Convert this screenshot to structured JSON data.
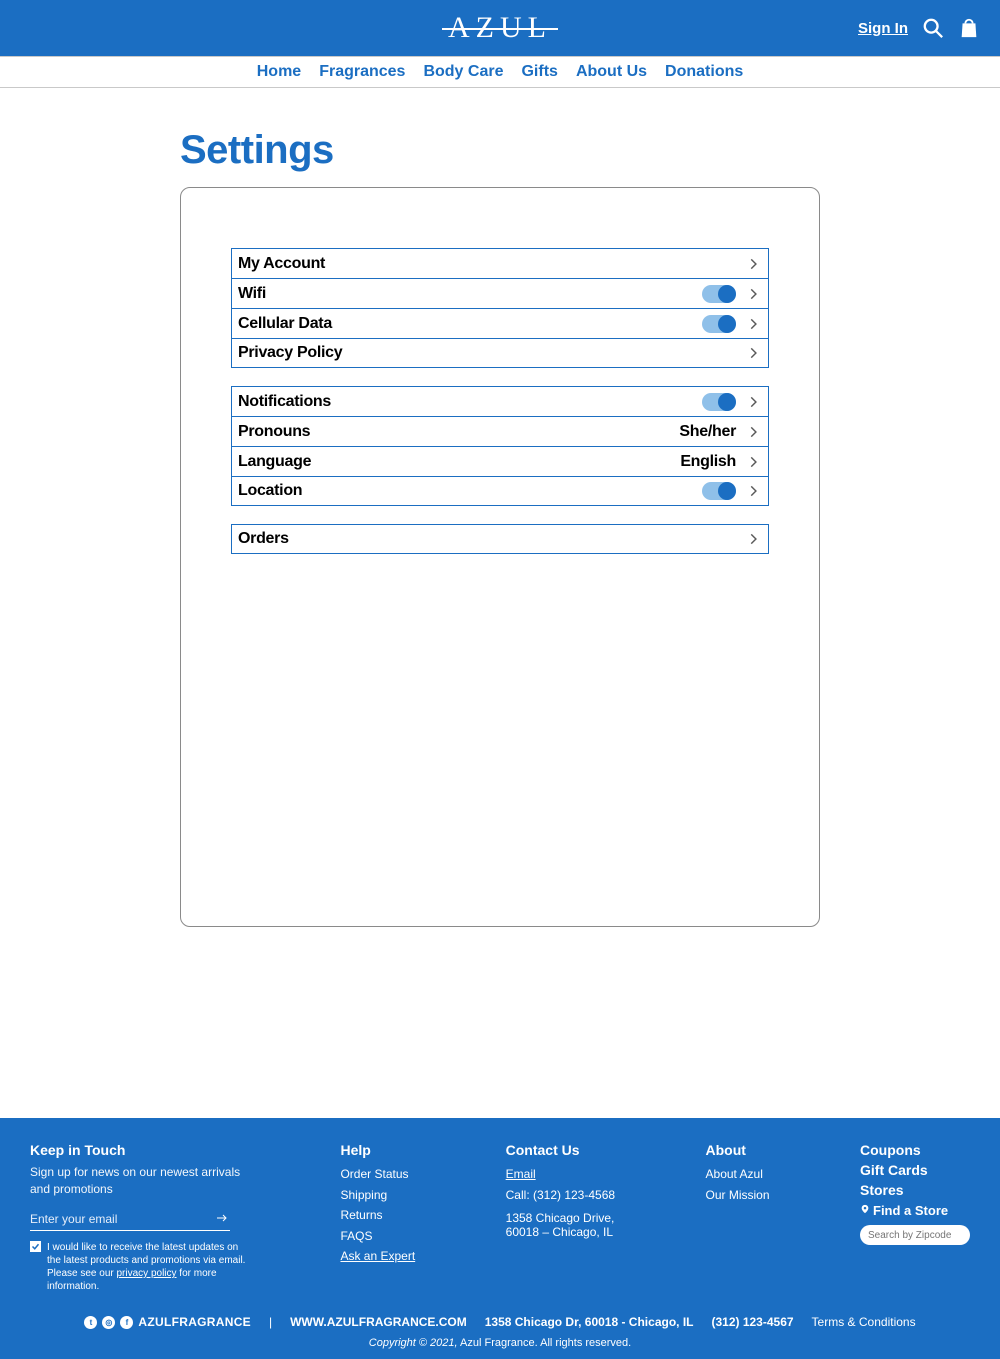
{
  "header": {
    "logo": "AZUL",
    "sign_in": "Sign In"
  },
  "nav": {
    "items": [
      "Home",
      "Fragrances",
      "Body Care",
      "Gifts",
      "About Us",
      "Donations"
    ]
  },
  "page": {
    "title": "Settings"
  },
  "settings": {
    "groups": [
      {
        "rows": [
          {
            "label": "My Account",
            "toggle": null,
            "value": null
          },
          {
            "label": "Wifi",
            "toggle": true,
            "value": null
          },
          {
            "label": "Cellular Data",
            "toggle": true,
            "value": null
          },
          {
            "label": "Privacy Policy",
            "toggle": null,
            "value": null
          }
        ]
      },
      {
        "rows": [
          {
            "label": "Notifications",
            "toggle": true,
            "value": null
          },
          {
            "label": "Pronouns",
            "toggle": null,
            "value": "She/her"
          },
          {
            "label": "Language",
            "toggle": null,
            "value": "English"
          },
          {
            "label": "Location",
            "toggle": true,
            "value": null
          }
        ]
      },
      {
        "rows": [
          {
            "label": "Orders",
            "toggle": null,
            "value": null
          }
        ]
      }
    ]
  },
  "footer": {
    "keep_in_touch": {
      "title": "Keep in Touch",
      "sub": "Sign up for news on our newest arrivals and promotions",
      "email_placeholder": "Enter your email",
      "consent_pre": "I would like to receive the latest updates on the latest products and promotions via email. Please see our ",
      "consent_link": "privacy policy",
      "consent_post": " for more information."
    },
    "help": {
      "title": "Help",
      "items": [
        "Order Status",
        "Shipping",
        "Returns",
        "FAQS",
        "Ask an Expert"
      ]
    },
    "contact": {
      "title": "Contact Us",
      "email": "Email",
      "call": "Call: (312) 123-4568",
      "addr1": "1358 Chicago Drive,",
      "addr2": "60018 – Chicago, IL"
    },
    "about": {
      "title": "About",
      "items": [
        "About Azul",
        "Our Mission"
      ]
    },
    "right": {
      "coupons": "Coupons",
      "gift_cards": "Gift Cards",
      "stores": "Stores",
      "find_a_store": "Find a Store",
      "zip_placeholder": "Search by Zipcode"
    },
    "bottom": {
      "handle": "AZULFRAGRANCE",
      "pipe": "|",
      "site": "WWW.AZULFRAGRANCE.COM",
      "addr": "1358 Chicago Dr,  60018 - Chicago, IL",
      "phone": "(312) 123-4567",
      "terms": "Terms & Conditions"
    },
    "copyright": {
      "c1": "Copyright © 2021,",
      "c2": " Azul Fragrance. All rights reserved."
    }
  }
}
